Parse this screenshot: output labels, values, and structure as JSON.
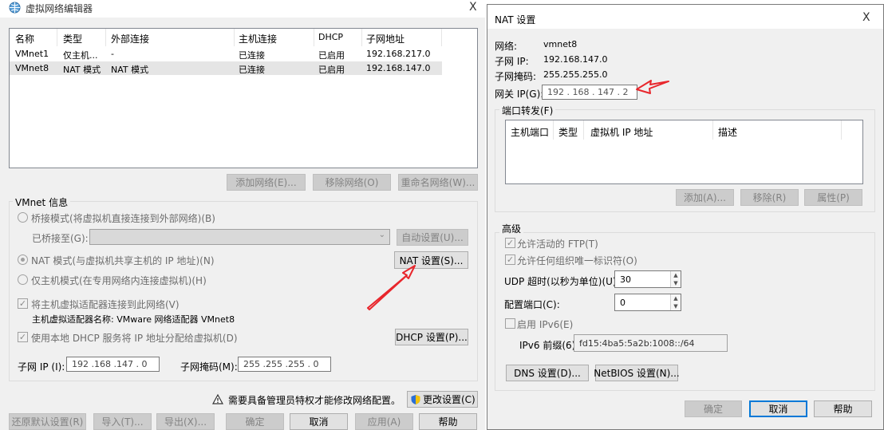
{
  "left": {
    "title": "虚拟网络编辑器",
    "close_label": "X",
    "table": {
      "headers": [
        "名称",
        "类型",
        "外部连接",
        "主机连接",
        "DHCP",
        "子网地址"
      ],
      "rows": [
        [
          "VMnet1",
          "仅主机...",
          "-",
          "已连接",
          "已启用",
          "192.168.217.0"
        ],
        [
          "VMnet8",
          "NAT 模式",
          "NAT 模式",
          "已连接",
          "已启用",
          "192.168.147.0"
        ]
      ]
    },
    "add_network": "添加网络(E)...",
    "remove_network": "移除网络(O)",
    "rename_network": "重命名网络(W)...",
    "vmnet_info": "VMnet 信息",
    "bridge_mode": "桥接模式(将虚拟机直接连接到外部网络)(B)",
    "bridged_to": "已桥接至(G):",
    "auto_settings": "自动设置(U)...",
    "nat_mode": "NAT 模式(与虚拟机共享主机的 IP 地址)(N)",
    "nat_settings": "NAT 设置(S)...",
    "host_only_mode": "仅主机模式(在专用网络内连接虚拟机)(H)",
    "connect_adapter": "将主机虚拟适配器连接到此网络(V)",
    "adapter_name": "主机虚拟适配器名称: VMware 网络适配器 VMnet8",
    "use_dhcp": "使用本地 DHCP 服务将 IP 地址分配给虚拟机(D)",
    "dhcp_settings": "DHCP 设置(P)...",
    "subnet_ip_label": "子网 IP (I):",
    "subnet_ip": "192 .168 .147 . 0",
    "subnet_mask_label": "子网掩码(M):",
    "subnet_mask": "255 .255 .255 . 0",
    "admin_warning": "需要具备管理员特权才能修改网络配置。",
    "change_settings": "更改设置(C)",
    "restore_defaults": "还原默认设置(R)",
    "import": "导入(T)...",
    "export": "导出(X)...",
    "ok": "确定",
    "cancel": "取消",
    "apply": "应用(A)",
    "help": "帮助"
  },
  "nat": {
    "title": "NAT 设置",
    "close_label": "X",
    "network_label": "网络:",
    "network_value": "vmnet8",
    "subnet_ip_label": "子网 IP:",
    "subnet_ip_value": "192.168.147.0",
    "subnet_mask_label": "子网掩码:",
    "subnet_mask_value": "255.255.255.0",
    "gateway_label": "网关 IP(G):",
    "gateway_value": "192 . 168 . 147 . 2",
    "port_forwarding": "端口转发(F)",
    "pf_headers": [
      "主机端口",
      "类型",
      "虚拟机 IP 地址",
      "描述"
    ],
    "add": "添加(A)...",
    "remove": "移除(R)",
    "properties": "属性(P)",
    "advanced": "高级",
    "allow_ftp": "允许活动的 FTP(T)",
    "allow_oui": "允许任何组织唯一标识符(O)",
    "udp_timeout_label": "UDP 超时(以秒为单位)(U):",
    "udp_timeout": "30",
    "config_port_label": "配置端口(C):",
    "config_port": "0",
    "enable_ipv6": "启用 IPv6(E)",
    "ipv6_prefix_label": "IPv6 前缀(6):",
    "ipv6_prefix": "fd15:4ba5:5a2b:1008::/64",
    "dns_settings": "DNS 设置(D)...",
    "netbios_settings": "NetBIOS 设置(N)...",
    "ok": "确定",
    "cancel": "取消",
    "help": "帮助"
  },
  "colors": {
    "arrow": "#e8262c",
    "accent": "#0078d7"
  },
  "icons": [
    "network-editor-icon",
    "warning-icon",
    "shield-icon",
    "close-icon",
    "arrow-annotation"
  ]
}
